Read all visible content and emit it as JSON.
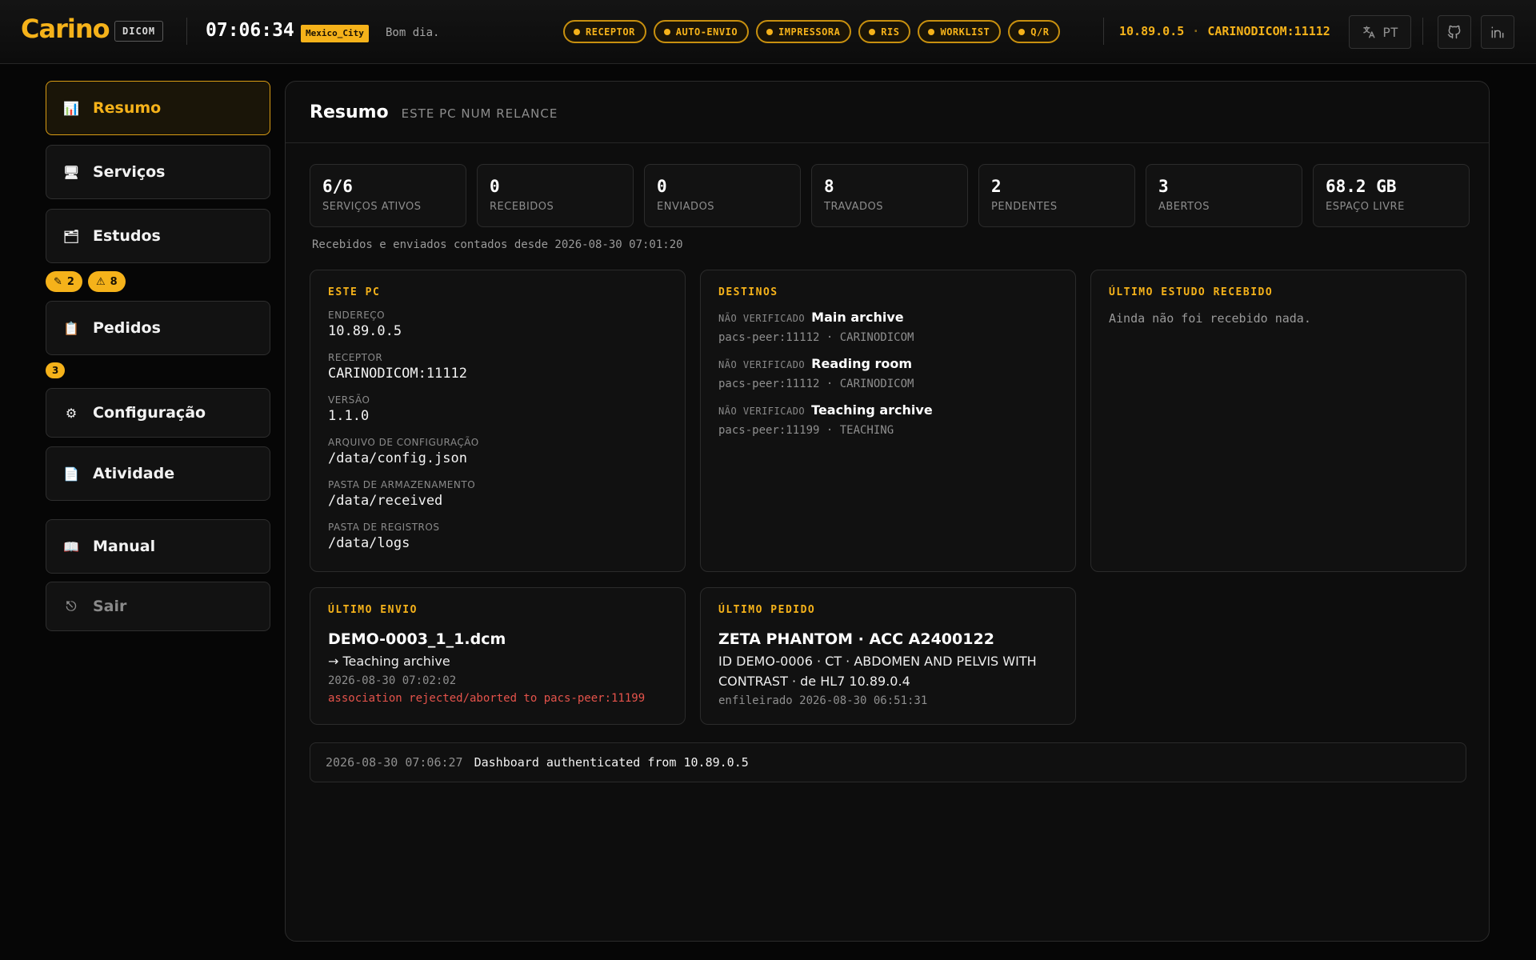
{
  "topbar": {
    "logo": "Carino",
    "badge": "DICOM",
    "clock": "07:06:34",
    "timezone": "Mexico_City",
    "greeting": "Bom dia.",
    "services": [
      "RECEPTOR",
      "AUTO-ENVIO",
      "IMPRESSORA",
      "RIS",
      "WORKLIST",
      "Q/R"
    ],
    "ip": "10.89.0.5",
    "ae": "CARINODICOM:11112",
    "lang": "PT",
    "accent_color": "#f5b21a"
  },
  "sidebar": {
    "items": [
      {
        "label": "Resumo",
        "icon": "chart-icon"
      },
      {
        "label": "Serviços",
        "icon": "monitor-icon"
      },
      {
        "label": "Estudos",
        "icon": "folder-icon"
      },
      {
        "label": "Pedidos",
        "icon": "clipboard-icon"
      },
      {
        "label": "Configuração",
        "icon": "gear-icon"
      },
      {
        "label": "Atividade",
        "icon": "document-icon"
      },
      {
        "label": "Manual",
        "icon": "book-icon"
      },
      {
        "label": "Sair",
        "icon": "logout-icon"
      }
    ],
    "estudos_badges": [
      {
        "icon": "pencil-icon",
        "count": "2"
      },
      {
        "icon": "warning-icon",
        "count": "8"
      }
    ],
    "pedidos_badge": "3"
  },
  "main": {
    "title": "Resumo",
    "subtitle": "ESTE PC NUM RELANCE",
    "stats": [
      {
        "value": "6/6",
        "label": "SERVIÇOS ATIVOS"
      },
      {
        "value": "0",
        "label": "RECEBIDOS"
      },
      {
        "value": "0",
        "label": "ENVIADOS"
      },
      {
        "value": "8",
        "label": "TRAVADOS"
      },
      {
        "value": "2",
        "label": "PENDENTES"
      },
      {
        "value": "3",
        "label": "ABERTOS"
      },
      {
        "value": "68.2 GB",
        "label": "ESPAÇO LIVRE"
      }
    ],
    "counted_since": "Recebidos e enviados contados desde 2026-08-30 07:01:20",
    "este_pc": {
      "title": "ESTE PC",
      "fields": [
        {
          "label": "ENDEREÇO",
          "value": "10.89.0.5"
        },
        {
          "label": "RECEPTOR",
          "value": "CARINODICOM:11112"
        },
        {
          "label": "VERSÃO",
          "value": "1.1.0"
        },
        {
          "label": "ARQUIVO DE CONFIGURAÇÃO",
          "value": "/data/config.json"
        },
        {
          "label": "PASTA DE ARMAZENAMENTO",
          "value": "/data/received"
        },
        {
          "label": "PASTA DE REGISTROS",
          "value": "/data/logs"
        }
      ]
    },
    "destinos": {
      "title": "DESTINOS",
      "items": [
        {
          "status": "NÃO VERIFICADO",
          "name": "Main archive",
          "address": "pacs-peer:11112 · CARINODICOM"
        },
        {
          "status": "NÃO VERIFICADO",
          "name": "Reading room",
          "address": "pacs-peer:11112 · CARINODICOM"
        },
        {
          "status": "NÃO VERIFICADO",
          "name": "Teaching archive",
          "address": "pacs-peer:11199 · TEACHING"
        }
      ]
    },
    "ultimo_estudo": {
      "title": "ÚLTIMO ESTUDO RECEBIDO",
      "empty": "Ainda não foi recebido nada."
    },
    "ultimo_envio": {
      "title": "ÚLTIMO ENVIO",
      "file": "DEMO-0003_1_1.dcm",
      "dest": "→ Teaching archive",
      "time": "2026-08-30 07:02:02",
      "error": "association rejected/aborted to pacs-peer:11199"
    },
    "ultimo_pedido": {
      "title": "ÚLTIMO PEDIDO",
      "patient": "ZETA PHANTOM · ACC A2400122",
      "detail": "ID DEMO-0006 · CT · ABDOMEN AND PELVIS WITH CONTRAST · de HL7 10.89.0.4",
      "queued": "enfileirado 2026-08-30 06:51:31"
    },
    "log": {
      "timestamp": "2026-08-30 07:06:27",
      "message": "Dashboard authenticated from 10.89.0.5"
    }
  }
}
